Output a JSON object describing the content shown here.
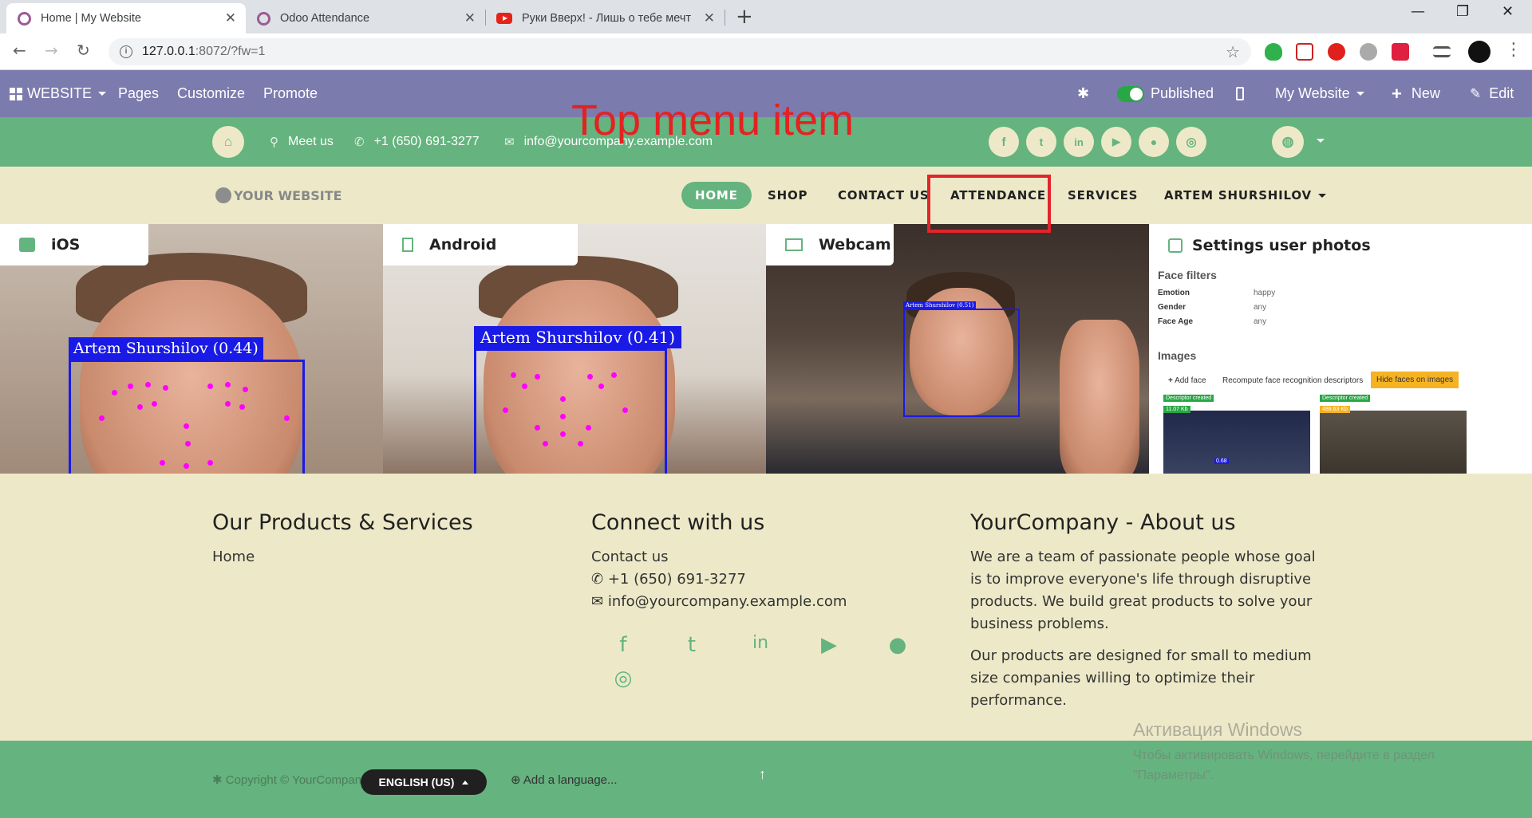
{
  "browser": {
    "tabs": [
      {
        "title": "Home | My Website",
        "active": true
      },
      {
        "title": "Odoo Attendance",
        "active": false
      },
      {
        "title": "Руки Вверх! - Лишь о тебе мечт",
        "active": false
      }
    ],
    "url_host": "127.0.0.1",
    "url_rest": ":8072/?fw=1"
  },
  "odoo_bar": {
    "website_label": "WEBSITE",
    "pages": "Pages",
    "customize": "Customize",
    "promote": "Promote",
    "published": "Published",
    "site_selector": "My Website",
    "new": "New",
    "edit": "Edit"
  },
  "contact_bar": {
    "meet_us": "Meet us",
    "phone": "+1 (650) 691-3277",
    "email": "info@yourcompany.example.com"
  },
  "annotation": {
    "text": "Top menu item",
    "color": "#e32222"
  },
  "main_nav": {
    "logo": "YOUR WEBSITE",
    "items": [
      "HOME",
      "SHOP",
      "CONTACT US",
      "ATTENDANCE",
      "SERVICES",
      "ARTEM SHURSHILOV"
    ]
  },
  "panels": {
    "ios": {
      "label": "iOS",
      "detection": "Artem Shurshilov (0.44)"
    },
    "android": {
      "label": "Android",
      "detection": "Artem Shurshilov (0.41)"
    },
    "webcam": {
      "label": "Webcam",
      "detection": "Artem Shurshilov (0.51)"
    },
    "settings": {
      "title": "Settings user photos",
      "face_filters_title": "Face filters",
      "filters": [
        {
          "key": "Emotion",
          "value": "happy"
        },
        {
          "key": "Gender",
          "value": "any"
        },
        {
          "key": "Face Age",
          "value": "any"
        }
      ],
      "images_title": "Images",
      "add_face": "Add face",
      "recompute": "Recompute face recognition descriptors",
      "hide_faces": "Hide faces on images",
      "card1_badge": "Descriptor created",
      "card1_size": "11.07 Kb",
      "card1_score": "0.68",
      "card2_badge": "Descriptor created",
      "card2_size": "488.63 Kb"
    }
  },
  "footer": {
    "col1_title": "Our Products & Services",
    "col1_link": "Home",
    "col2_title": "Connect with us",
    "col2_contact": "Contact us",
    "col2_phone": "+1 (650) 691-3277",
    "col2_email": "info@yourcompany.example.com",
    "col3_title": "YourCompany - About us",
    "col3_p1": "We are a team of passionate people whose goal is to improve everyone's life through disruptive products. We build great products to solve your business problems.",
    "col3_p2": "Our products are designed for small to medium size companies willing to optimize their performance.",
    "copyright": "Copyright © YourCompany",
    "language": "ENGLISH (US)",
    "add_language": "Add a language..."
  },
  "windows_activation": {
    "title": "Активация Windows",
    "line1": "Чтобы активировать Windows, перейдите в раздел",
    "line2": "\"Параметры\"."
  },
  "colors": {
    "odoo_purple": "#7c7bad",
    "brand_green": "#65b37e",
    "beige": "#ede9c8",
    "bbox_blue": "#1a1ae6",
    "landmark_magenta": "#ff00ff"
  }
}
